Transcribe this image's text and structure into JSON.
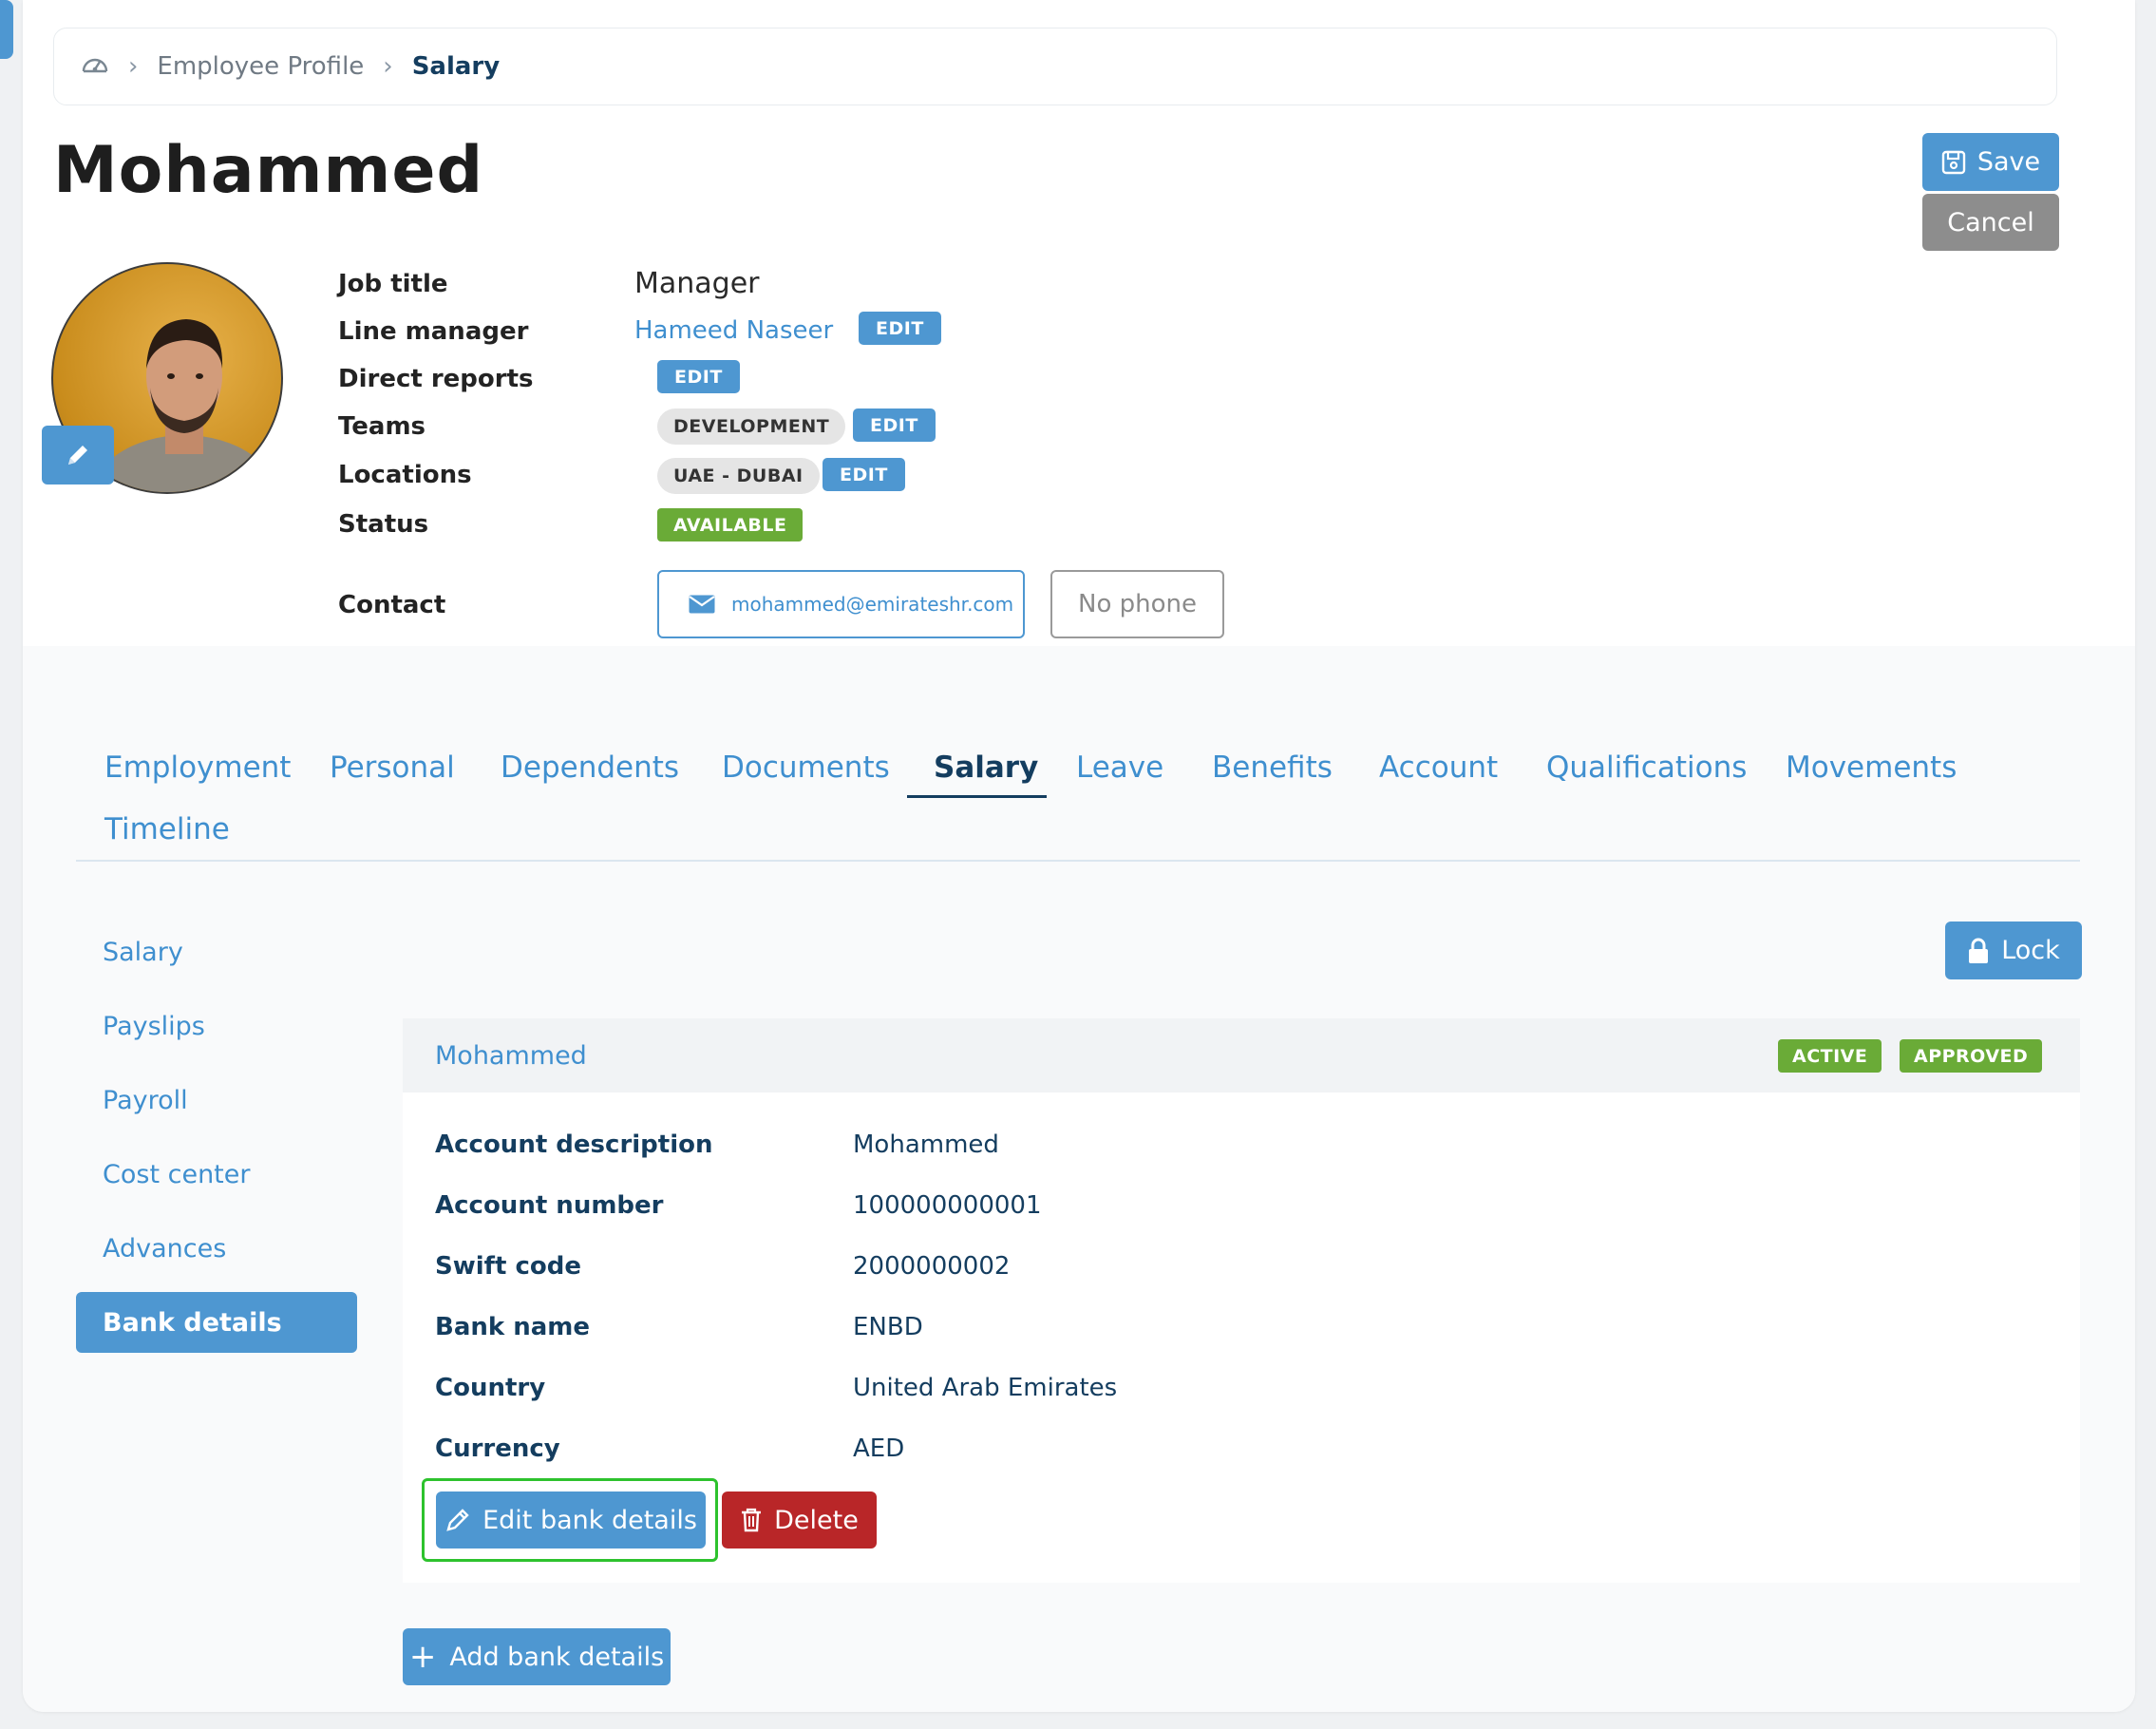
{
  "breadcrumb": {
    "home_icon": "dashboard-gauge-icon",
    "items": [
      "Employee Profile",
      "Salary"
    ]
  },
  "employee": {
    "name": "Mohammed"
  },
  "actions": {
    "save_label": "Save",
    "cancel_label": "Cancel"
  },
  "details": {
    "job_title_label": "Job title",
    "job_title": "Manager",
    "line_manager_label": "Line manager",
    "line_manager": "Hameed Naseer",
    "direct_reports_label": "Direct reports",
    "teams_label": "Teams",
    "team": "DEVELOPMENT",
    "locations_label": "Locations",
    "location": "UAE - DUBAI",
    "status_label": "Status",
    "status": "AVAILABLE",
    "contact_label": "Contact",
    "email": "mohammed@emirateshr.com",
    "phone": "No phone",
    "edit_label": "EDIT"
  },
  "tabs": [
    {
      "label": "Employment"
    },
    {
      "label": "Personal"
    },
    {
      "label": "Dependents"
    },
    {
      "label": "Documents"
    },
    {
      "label": "Salary",
      "active": true
    },
    {
      "label": "Leave"
    },
    {
      "label": "Benefits"
    },
    {
      "label": "Account"
    },
    {
      "label": "Qualifications"
    },
    {
      "label": "Movements"
    },
    {
      "label": "Timeline"
    }
  ],
  "sidebar": {
    "items": [
      {
        "label": "Salary"
      },
      {
        "label": "Payslips"
      },
      {
        "label": "Payroll"
      },
      {
        "label": "Cost center"
      },
      {
        "label": "Advances"
      },
      {
        "label": "Bank details",
        "active": true
      }
    ]
  },
  "lock_label": "Lock",
  "bank": {
    "title": "Mohammed",
    "badges": [
      "ACTIVE",
      "APPROVED"
    ],
    "fields": [
      {
        "label": "Account description",
        "value": "Mohammed"
      },
      {
        "label": "Account number",
        "value": "100000000001"
      },
      {
        "label": "Swift code",
        "value": "2000000002"
      },
      {
        "label": "Bank name",
        "value": "ENBD"
      },
      {
        "label": "Country",
        "value": "United Arab Emirates"
      },
      {
        "label": "Currency",
        "value": "AED"
      }
    ],
    "edit_label": "Edit bank details",
    "delete_label": "Delete",
    "add_label": "Add bank details"
  },
  "colors": {
    "primary": "#4e97d1",
    "navy": "#143d5f",
    "success": "#6aab37",
    "danger": "#b92628",
    "highlight": "#2dc22d"
  }
}
